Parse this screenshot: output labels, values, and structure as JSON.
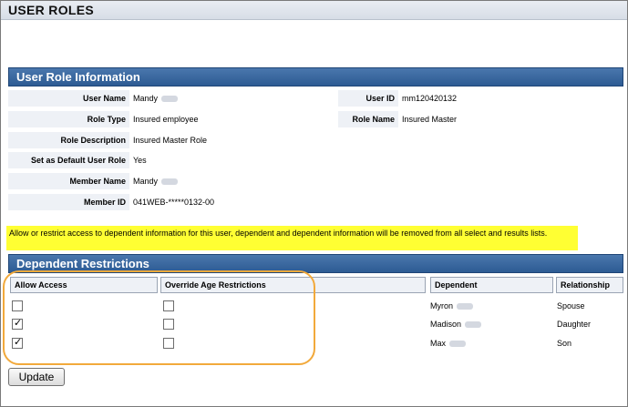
{
  "page": {
    "title": "USER ROLES"
  },
  "user_role_info": {
    "heading": "User Role Information",
    "rows": [
      {
        "label": "User Name",
        "value": "Mandy"
      },
      {
        "label": "Role Type",
        "value": "Insured employee"
      },
      {
        "label": "Role Description",
        "value": "Insured Master Role"
      },
      {
        "label": "Set as Default User Role",
        "value": "Yes"
      },
      {
        "label": "Member Name",
        "value": "Mandy"
      },
      {
        "label": "Member ID",
        "value": "041WEB-*****0132-00"
      }
    ],
    "right_rows": [
      {
        "label": "User ID",
        "value": "mm120420132"
      },
      {
        "label": "Role Name",
        "value": "Insured Master"
      }
    ]
  },
  "notice": "Allow or restrict access to dependent information for this user, dependent and dependent information will be removed from all select and results lists.",
  "dependent_restrictions": {
    "heading": "Dependent Restrictions",
    "columns": [
      "Allow Access",
      "Override Age Restrictions",
      "Dependent",
      "Relationship"
    ],
    "rows": [
      {
        "allow_access": false,
        "override_age": false,
        "dependent": "Myron",
        "relationship": "Spouse"
      },
      {
        "allow_access": true,
        "override_age": false,
        "dependent": "Madison",
        "relationship": "Daughter"
      },
      {
        "allow_access": true,
        "override_age": false,
        "dependent": "Max",
        "relationship": "Son"
      }
    ]
  },
  "buttons": {
    "update": "Update"
  },
  "colors": {
    "section_bar": "#2d5b93",
    "notice_bg": "#ffff33",
    "highlight": "#f2a93b"
  }
}
